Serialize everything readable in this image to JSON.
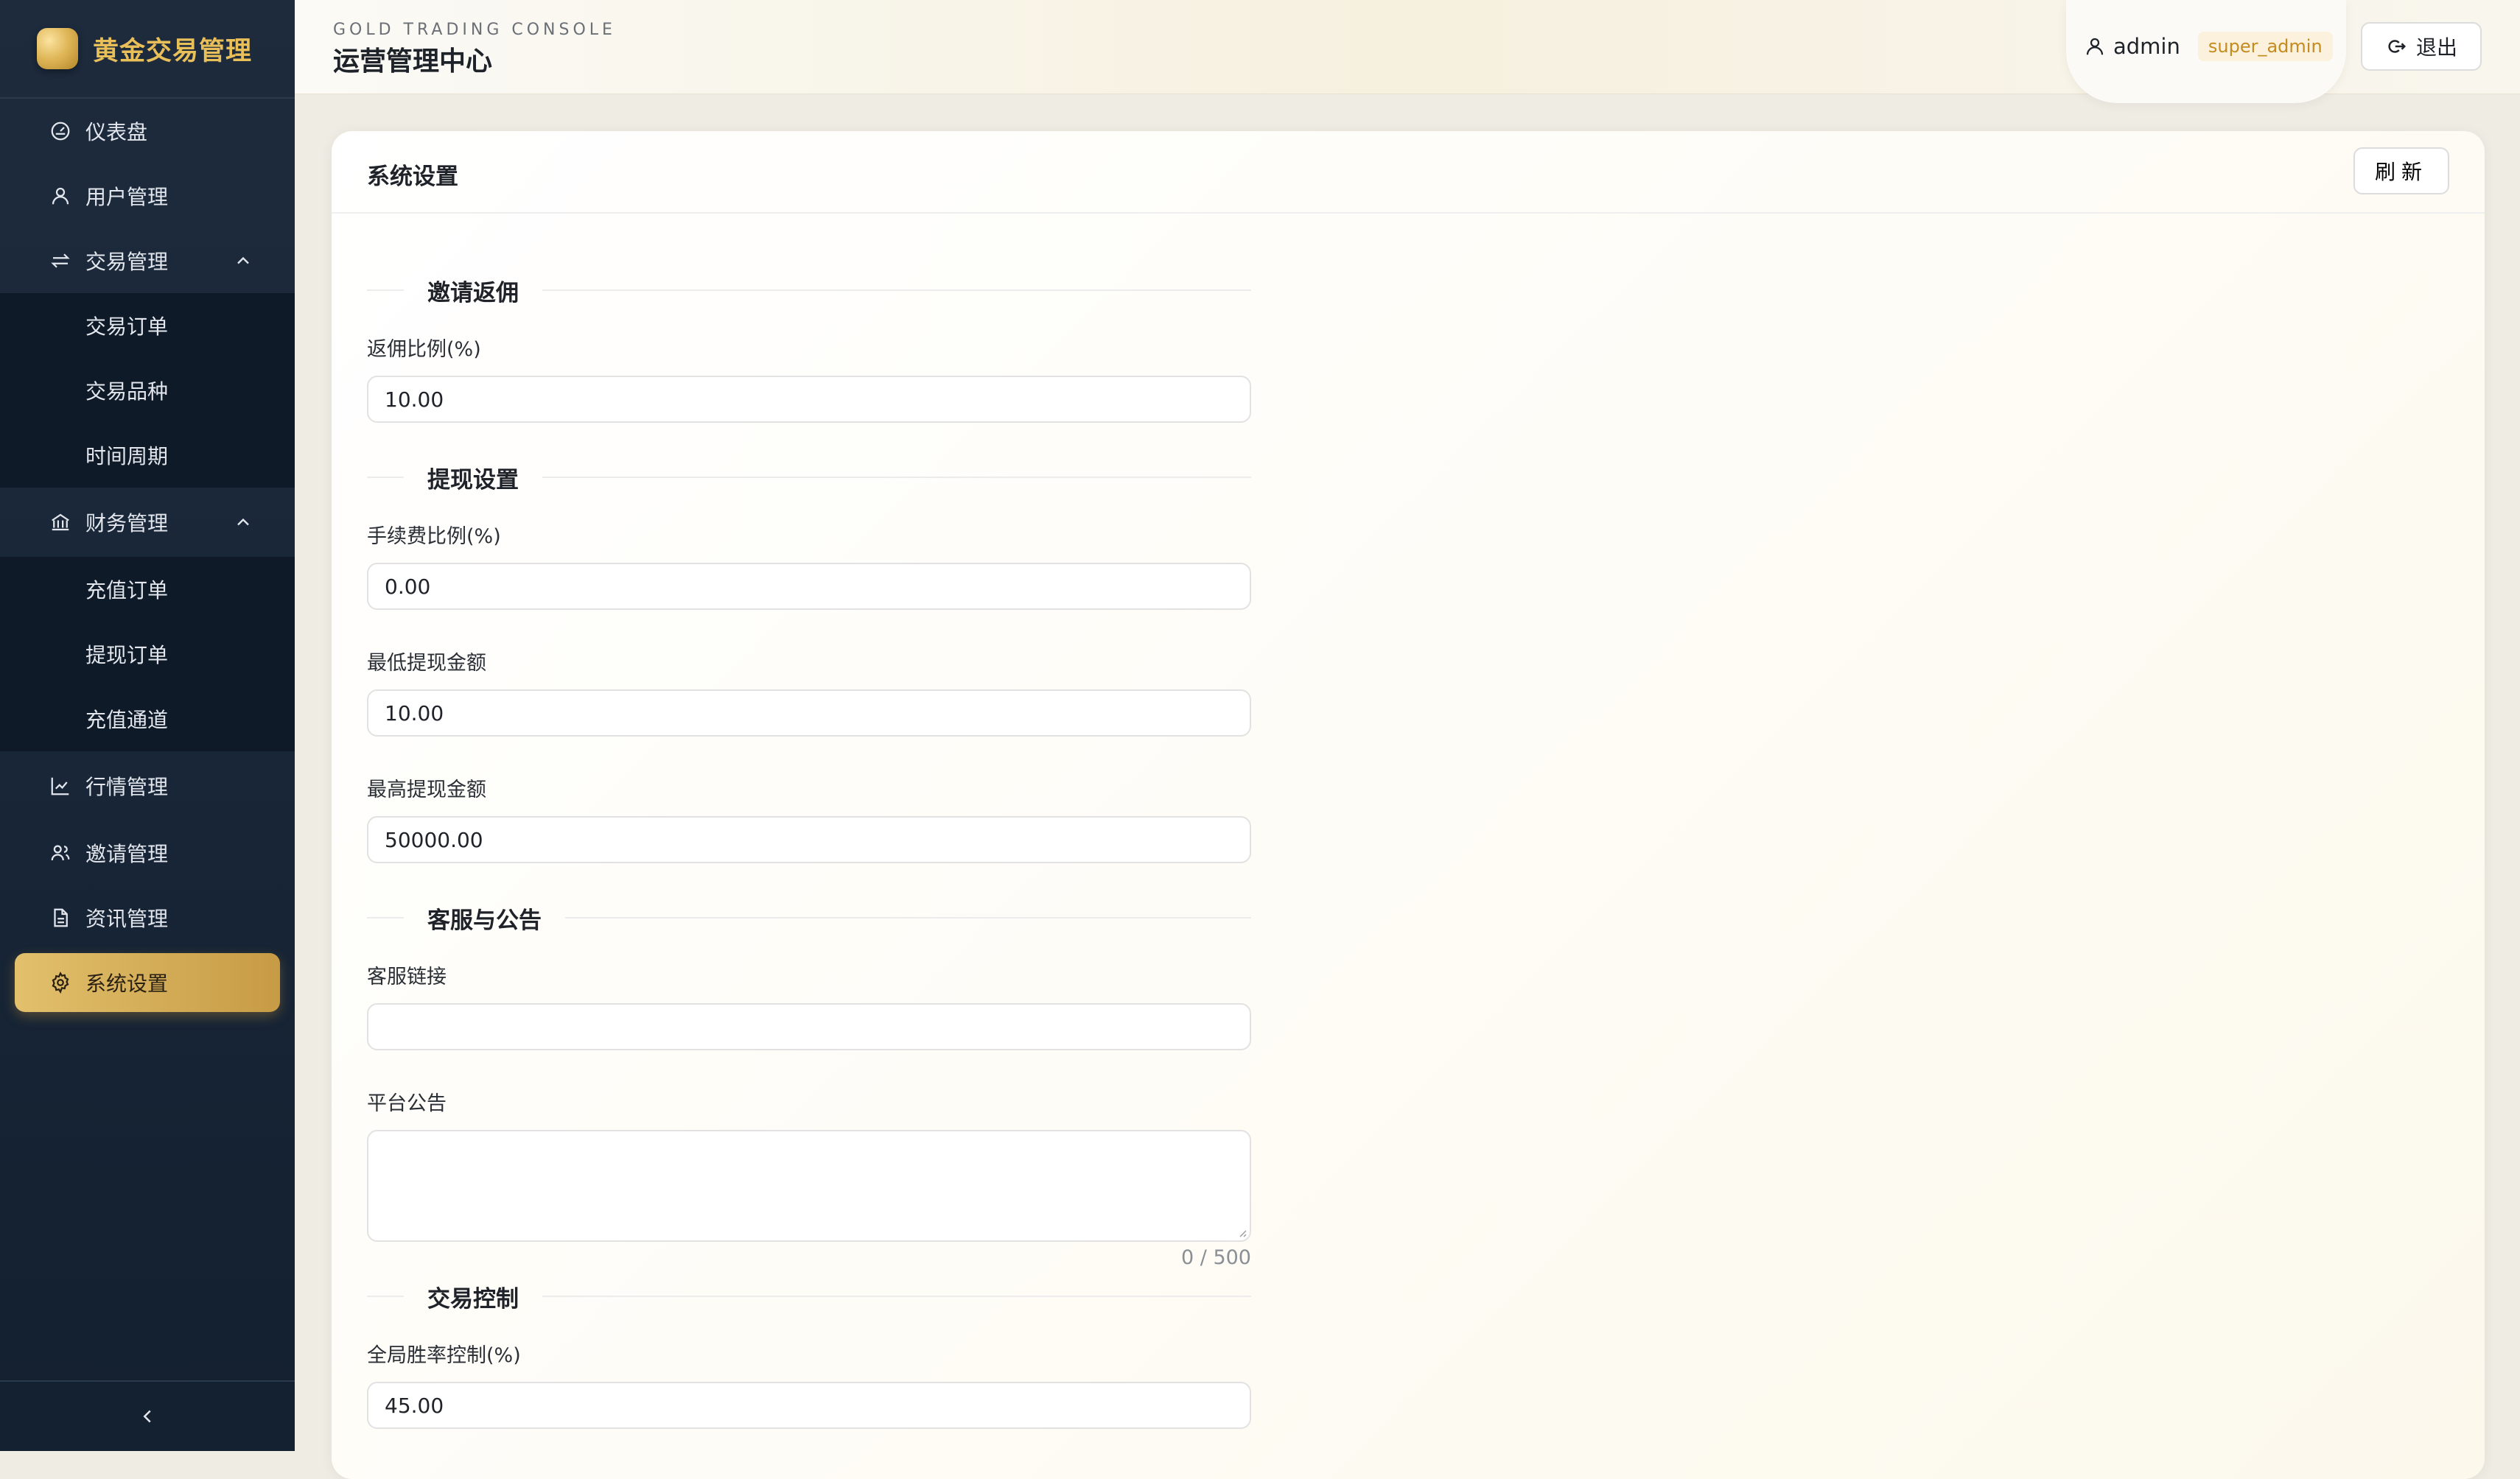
{
  "brand": {
    "name": "黄金交易管理"
  },
  "sidebar": {
    "items": [
      {
        "label": "仪表盘",
        "icon": "dashboard-icon"
      },
      {
        "label": "用户管理",
        "icon": "user-icon"
      },
      {
        "label": "交易管理",
        "icon": "exchange-icon",
        "expanded": true,
        "children": [
          {
            "label": "交易订单"
          },
          {
            "label": "交易品种"
          },
          {
            "label": "时间周期"
          }
        ]
      },
      {
        "label": "财务管理",
        "icon": "bank-icon",
        "expanded": true,
        "children": [
          {
            "label": "充值订单"
          },
          {
            "label": "提现订单"
          },
          {
            "label": "充值通道"
          }
        ]
      },
      {
        "label": "行情管理",
        "icon": "chart-line-icon"
      },
      {
        "label": "邀请管理",
        "icon": "users-icon"
      },
      {
        "label": "资讯管理",
        "icon": "document-icon"
      },
      {
        "label": "系统设置",
        "icon": "gear-icon",
        "active": true
      }
    ],
    "collapse_icon": "chevron-left-icon"
  },
  "header": {
    "subtitle": "GOLD TRADING CONSOLE",
    "title": "运营管理中心",
    "user": {
      "name": "admin",
      "role": "super_admin"
    },
    "logout_label": "退出"
  },
  "card": {
    "title": "系统设置",
    "refresh_label": "刷新",
    "sections": {
      "invite": {
        "title": "邀请返佣",
        "commission_label": "返佣比例(%)",
        "commission_value": "10.00"
      },
      "withdraw": {
        "title": "提现设置",
        "fee_label": "手续费比例(%)",
        "fee_value": "0.00",
        "min_label": "最低提现金额",
        "min_value": "10.00",
        "max_label": "最高提现金额",
        "max_value": "50000.00"
      },
      "service": {
        "title": "客服与公告",
        "link_label": "客服链接",
        "link_value": "",
        "notice_label": "平台公告",
        "notice_value": "",
        "notice_counter": "0 / 500"
      },
      "trade": {
        "title": "交易控制",
        "winrate_label": "全局胜率控制(%)",
        "winrate_value": "45.00"
      }
    }
  },
  "colors": {
    "sidebar_bg": "#1b2a3c",
    "submenu_bg": "#0e1a28",
    "brand_gold": "#e9bf5a",
    "active_gold": "#d4ad58",
    "role_text": "#c48b1f"
  }
}
